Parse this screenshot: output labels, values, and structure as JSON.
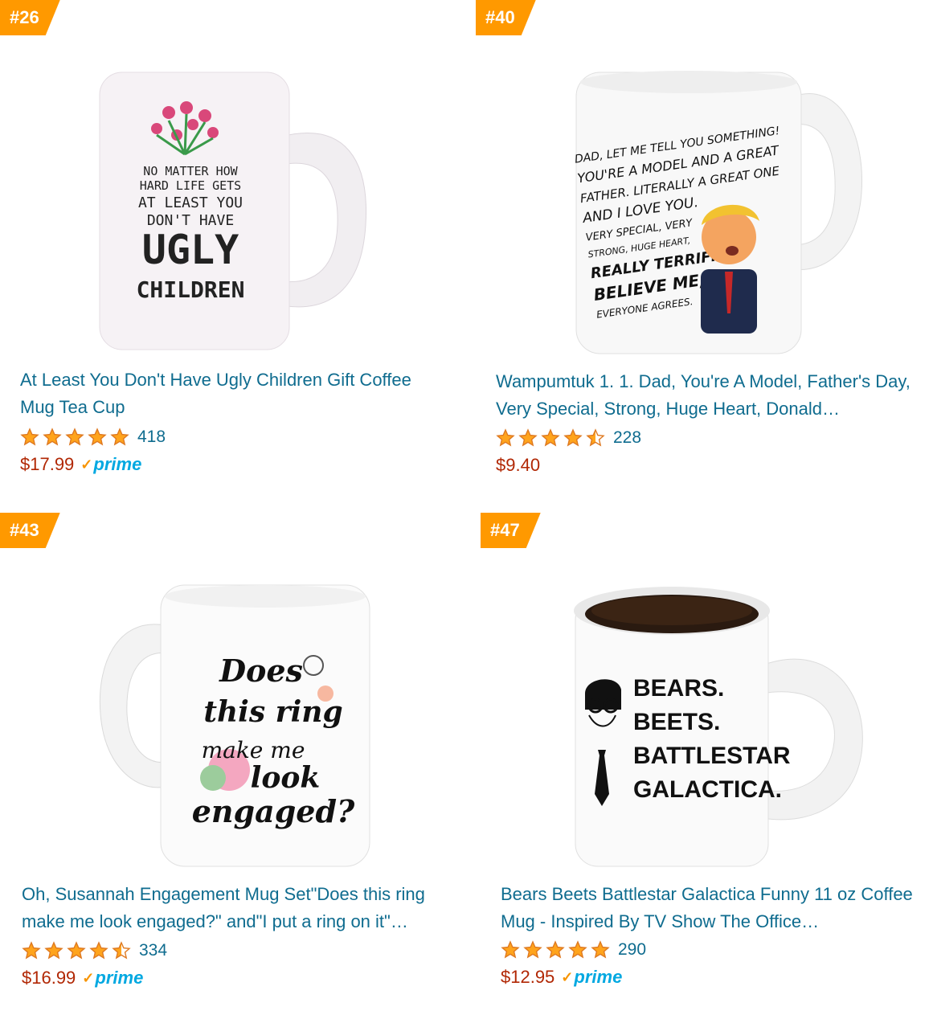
{
  "products": [
    {
      "rank": "#26",
      "title": "At Least You Don't Have Ugly Children Gift Coffee Mug Tea Cup",
      "rating": 5,
      "count": "418",
      "price": "$17.99",
      "prime": "prime",
      "mug_text": [
        "NO MATTER HOW",
        "HARD LIFE GETS",
        "AT LEAST YOU",
        "DON'T HAVE",
        "UGLY",
        "CHILDREN"
      ]
    },
    {
      "rank": "#40",
      "title": "Wampumtuk 1. 1. Dad, You're A Model, Father's Day, Very Special, Strong, Huge Heart, Donald…",
      "rating": 4.5,
      "count": "228",
      "price": "$9.40",
      "prime": "",
      "mug_text": [
        "DAD, LET ME TELL YOU SOMETHING!",
        "YOU'RE A MODEL AND A GREAT",
        "FATHER. LITERALLY A GREAT ONE",
        "AND I LOVE YOU.",
        "VERY SPECIAL, VERY",
        "STRONG, HUGE HEART,",
        "REALLY TERRIFIC.",
        "BELIEVE ME,",
        "EVERYONE AGREES."
      ]
    },
    {
      "rank": "#43",
      "title": "Oh, Susannah Engagement Mug Set\"Does this ring make me look engaged?\" and\"I put a ring on it\"…",
      "rating": 4.5,
      "count": "334",
      "price": "$16.99",
      "prime": "prime",
      "mug_text": [
        "Does",
        "this ring",
        "make me",
        "look",
        "engaged?"
      ]
    },
    {
      "rank": "#47",
      "title": "Bears Beets Battlestar Galactica Funny 11 oz Coffee Mug - Inspired By TV Show The Office…",
      "rating": 5,
      "count": "290",
      "price": "$12.95",
      "prime": "prime",
      "mug_text": [
        "BEARS.",
        "BEETS.",
        "BATTLESTAR",
        "GALACTICA."
      ]
    }
  ],
  "colors": {
    "badge": "#ff9900",
    "link": "#0f6c8f",
    "price": "#b12704",
    "prime": "#00a8e1",
    "star": "#ffa41c"
  }
}
